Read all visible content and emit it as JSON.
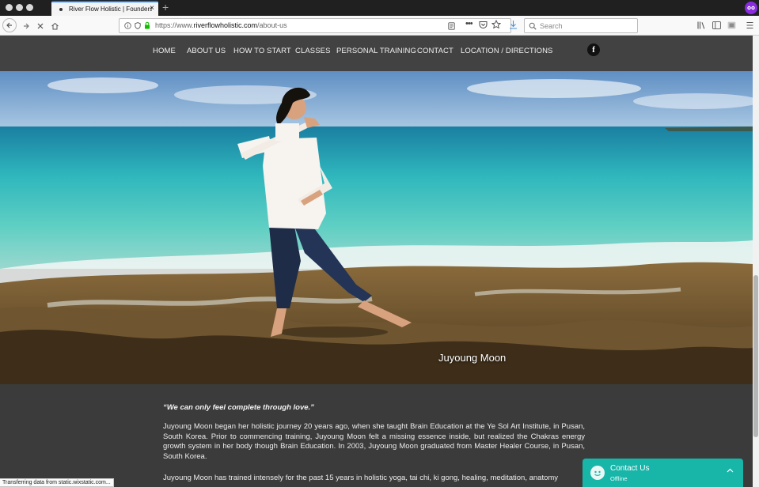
{
  "browser": {
    "tab_title": "River Flow Holistic | Founders",
    "url_domain": "https://www.",
    "url_host": "riverflowholistic.com",
    "url_path": "/about-us",
    "search_placeholder": "Search",
    "status_text": "Transferring data from static.wixstatic.com...",
    "accent_color": "#0a84ff"
  },
  "site": {
    "nav": [
      "HOME",
      "ABOUT US",
      "HOW TO START",
      "CLASSES",
      "PERSONAL TRAINING",
      "CONTACT",
      "LOCATION / DIRECTIONS"
    ],
    "social_icon": "facebook-icon",
    "hero_caption": "Juyoung Moon",
    "quote": "“We can only feel complete through love.”",
    "paragraphs": [
      "Juyoung Moon began her holistic journey 20 years ago, when she taught Brain Education at the Ye Sol Art Institute, in Pusan, South Korea. Prior to commencing training, Juyoung Moon felt a missing essence inside, but realized the Chakras energy growth system in her body though Brain Education. In 2003, Juyoung Moon graduated from Master Healer Course, in Pusan, South Korea.",
      "Juyoung Moon has trained intensely for the past 15 years in holistic yoga, tai chi, ki gong, healing, meditation, anatomy"
    ],
    "header_color": "#424242",
    "body_color": "#3b3b3b"
  },
  "chat": {
    "title": "Contact Us",
    "status": "Offline",
    "color": "#18b5a9"
  }
}
